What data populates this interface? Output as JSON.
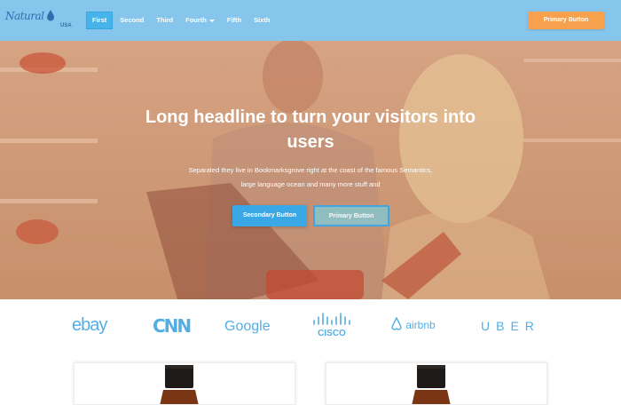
{
  "brand": {
    "logo_text": "Natural",
    "logo_sub": "USA"
  },
  "nav": {
    "items": [
      {
        "label": "First",
        "active": true
      },
      {
        "label": "Second"
      },
      {
        "label": "Third"
      },
      {
        "label": "Fourth",
        "dropdown": true
      },
      {
        "label": "Fifth"
      },
      {
        "label": "Sixth"
      }
    ],
    "cta_label": "Primary Button"
  },
  "hero": {
    "title": "Long headline to turn your visitors into users",
    "subtitle": "Separated they live in Bookmarksgrove right at the coast of the famous Semantics, large language ocean and many more stuff and",
    "secondary_label": "Secondary Button",
    "primary_label": "Primary Button"
  },
  "logos": {
    "ebay": "ebay",
    "cnn": "CNN",
    "google": "Google",
    "cisco": "CISCO",
    "airbnb": "airbnb",
    "uber": "UBER"
  },
  "colors": {
    "nav_bg": "#87c6ec",
    "accent_blue": "#3aa7e6",
    "accent_orange": "#f7a14e",
    "logo_blue": "#54aee4"
  }
}
